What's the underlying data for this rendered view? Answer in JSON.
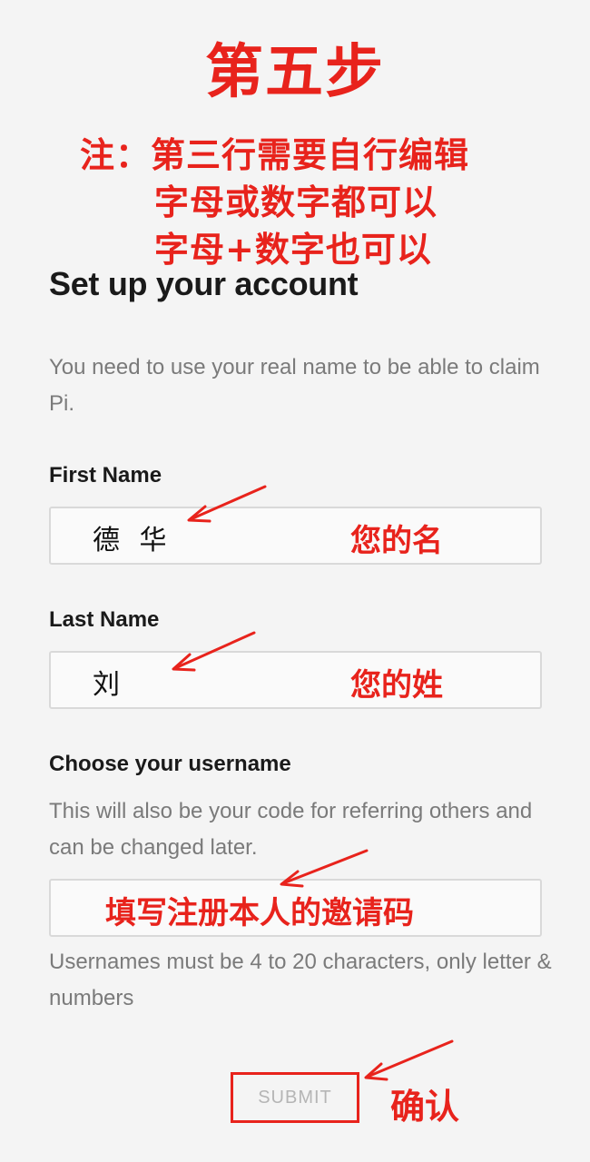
{
  "annotations": {
    "step_title": "第五步",
    "note_line_1": "注：第三行需要自行编辑",
    "note_line_2": "字母或数字都可以",
    "note_line_3": "字母+数字也可以",
    "first_name_hint": "您的名",
    "last_name_hint": "您的姓",
    "username_hint": "填写注册本人的邀请码",
    "submit_hint": "确认",
    "accent_color": "#e8231c"
  },
  "form": {
    "title": "Set up your account",
    "subtitle": "You need to use your real name to be able to claim Pi.",
    "first_name": {
      "label": "First Name",
      "value": "德 华"
    },
    "last_name": {
      "label": "Last Name",
      "value": "刘"
    },
    "username": {
      "label": "Choose your username",
      "help": "This will also be your code for referring others and can be changed later.",
      "value": "",
      "rules": "Usernames must be 4 to 20 characters, only letter & numbers"
    },
    "submit_label": "SUBMIT"
  }
}
